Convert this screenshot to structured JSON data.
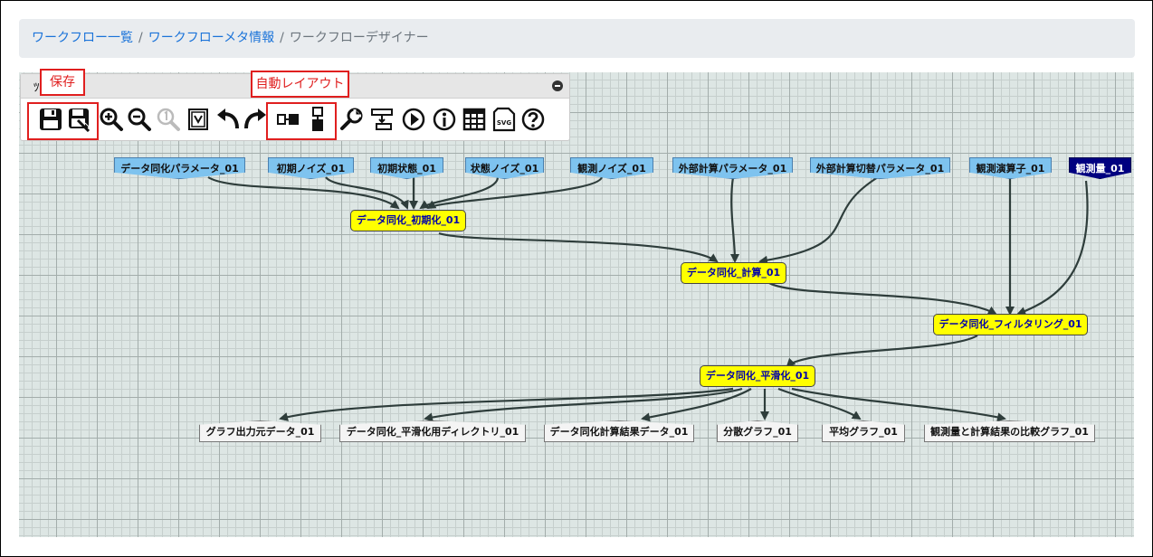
{
  "breadcrumb": {
    "items": [
      "ワークフロー一覧",
      "ワークフローメタ情報",
      "ワークフローデザイナー"
    ],
    "separator": "/"
  },
  "toolbar": {
    "title": "ﾂ",
    "icons": [
      "save-icon",
      "save-as-icon",
      "zoom-in-icon",
      "zoom-out-icon",
      "zoom-reset-icon",
      "fit-view-icon",
      "undo-icon",
      "redo-icon",
      "horizontal-layout-icon",
      "vertical-layout-icon",
      "settings-wrench-icon",
      "align-icon",
      "run-icon",
      "info-icon",
      "table-icon",
      "svg-export-icon",
      "help-icon"
    ],
    "svg_label": "SVG"
  },
  "annotations": {
    "save": "保存",
    "auto_layout": "自動レイアウト"
  },
  "nodes": {
    "inputs": [
      "データ同化パラメータ_01",
      "初期ノイズ_01",
      "初期状態_01",
      "状態ノイズ_01",
      "観測ノイズ_01",
      "外部計算パラメータ_01",
      "外部計算切替パラメータ_01",
      "観測演算子_01",
      "観測量_01"
    ],
    "processes": [
      "データ同化_初期化_01",
      "データ同化_計算_01",
      "データ同化_フィルタリング_01",
      "データ同化_平滑化_01"
    ],
    "outputs": [
      "グラフ出力元データ_01",
      "データ同化_平滑化用ディレクトリ_01",
      "データ同化計算結果データ_01",
      "分散グラフ_01",
      "平均グラフ_01",
      "観測量と計算結果の比較グラフ_01"
    ]
  },
  "colors": {
    "input_node": "#7ec3ef",
    "observed_node": "#000080",
    "process_node": "#ffff00",
    "process_text": "#0000aa",
    "annotation": "#e01f1f",
    "link": "#1a73d9",
    "edge": "#2e3d3b"
  }
}
